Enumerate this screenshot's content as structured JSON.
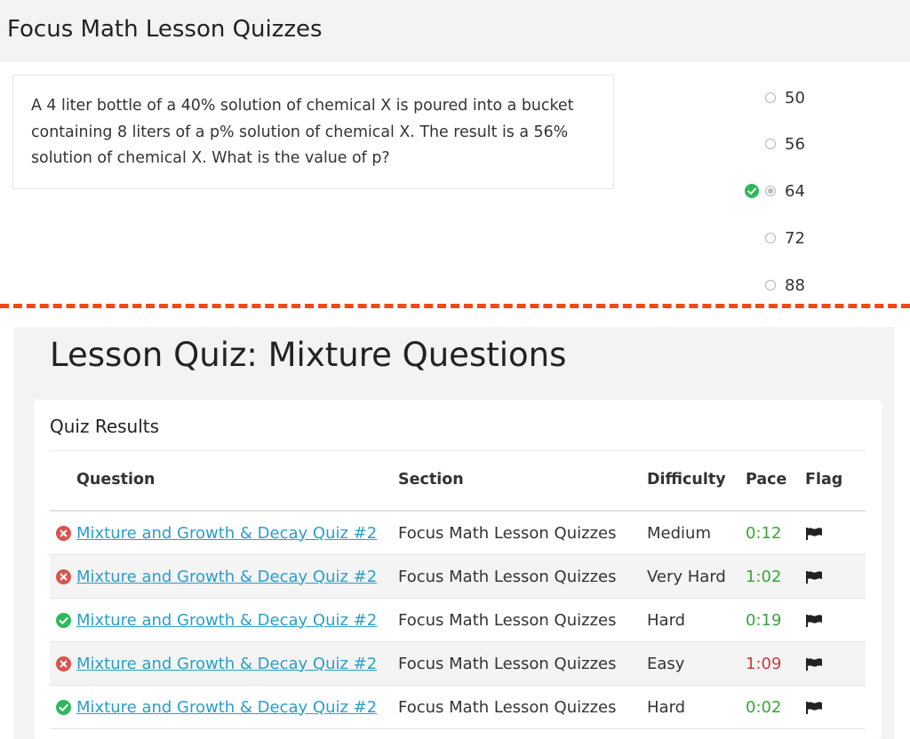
{
  "header": {
    "title": "Focus Math Lesson Quizzes"
  },
  "question": {
    "lines": [
      "A 4 liter bottle of a 40% solution of chemical X is poured into a bucket",
      "containing 8 liters of a p% solution of chemical X. The result is a 56%",
      "solution of chemical X. What is the value of p?"
    ]
  },
  "choices": [
    {
      "label": "50",
      "selected": false,
      "correct": false
    },
    {
      "label": "56",
      "selected": false,
      "correct": false
    },
    {
      "label": "64",
      "selected": true,
      "correct": true
    },
    {
      "label": "72",
      "selected": false,
      "correct": false
    },
    {
      "label": "88",
      "selected": false,
      "correct": false
    }
  ],
  "colors": {
    "divider": "#ee4a14",
    "correct": "#2eb85c",
    "incorrect": "#d9534f",
    "link": "#2a9fc9",
    "pace_good": "#3aa53a",
    "pace_bad": "#c9403c"
  },
  "quiz": {
    "title": "Lesson Quiz: Mixture Questions",
    "results_heading": "Quiz Results",
    "columns": {
      "question": "Question",
      "section": "Section",
      "difficulty": "Difficulty",
      "pace": "Pace",
      "flag": "Flag"
    },
    "rows": [
      {
        "status": "incorrect",
        "question": "Mixture and Growth & Decay Quiz #2",
        "section": "Focus Math Lesson Quizzes",
        "difficulty": "Medium",
        "pace": "0:12",
        "pace_status": "good",
        "flag_icon": "flag-icon"
      },
      {
        "status": "incorrect",
        "question": "Mixture and Growth & Decay Quiz #2",
        "section": "Focus Math Lesson Quizzes",
        "difficulty": "Very Hard",
        "pace": "1:02",
        "pace_status": "good",
        "flag_icon": "flag-icon"
      },
      {
        "status": "correct",
        "question": "Mixture and Growth & Decay Quiz #2",
        "section": "Focus Math Lesson Quizzes",
        "difficulty": "Hard",
        "pace": "0:19",
        "pace_status": "good",
        "flag_icon": "flag-icon"
      },
      {
        "status": "incorrect",
        "question": "Mixture and Growth & Decay Quiz #2",
        "section": "Focus Math Lesson Quizzes",
        "difficulty": "Easy",
        "pace": "1:09",
        "pace_status": "bad",
        "flag_icon": "flag-icon"
      },
      {
        "status": "correct",
        "question": "Mixture and Growth & Decay Quiz #2",
        "section": "Focus Math Lesson Quizzes",
        "difficulty": "Hard",
        "pace": "0:02",
        "pace_status": "good",
        "flag_icon": "flag-icon"
      }
    ]
  }
}
